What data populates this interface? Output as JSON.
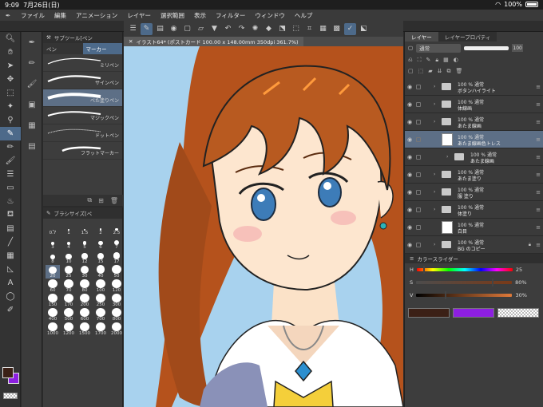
{
  "status": {
    "time": "9:09",
    "date": "7月26日(日)",
    "battery": "100%"
  },
  "menu": [
    "ファイル",
    "編集",
    "アニメーション",
    "レイヤー",
    "選択範囲",
    "表示",
    "フィルター",
    "ウィンドウ",
    "ヘルプ"
  ],
  "subtool": {
    "title": "サブツール[ペン",
    "tabs": [
      "ペン",
      "マーカー"
    ],
    "brushes": [
      "ミリペン",
      "サインペン",
      "べた塗りペン",
      "マジックペン",
      "ドットペン",
      "フラットマーカー"
    ],
    "selected_brush": "べた塗りペン"
  },
  "brushsize": {
    "title": "ブラシサイズ[ペ",
    "sizes": [
      "0.7",
      "1",
      "1.5",
      "2",
      "2.5",
      "3",
      "4",
      "5",
      "6",
      "7",
      "8",
      "10",
      "12",
      "15",
      "17",
      "20",
      "25",
      "30",
      "40",
      "50",
      "60",
      "70",
      "80",
      "100",
      "120",
      "150",
      "170",
      "200",
      "250",
      "300",
      "400",
      "500",
      "600",
      "700",
      "800",
      "1000",
      "1200",
      "1500",
      "1700",
      "2000"
    ],
    "selected": "20"
  },
  "canvas": {
    "tab_title": "イラスト64* (ポストカード 100.00 x 148.00mm 350dpi 361.7%)"
  },
  "layers": {
    "tabs": [
      "レイヤー",
      "レイヤープロパティ"
    ],
    "blend_mode": "通常",
    "opacity": "100",
    "items": [
      {
        "line1": "100 % 通常",
        "line2": "ボタンハイライト",
        "kind": "folder"
      },
      {
        "line1": "100 % 通常",
        "line2": "体線画",
        "kind": "folder"
      },
      {
        "line1": "100 % 通常",
        "line2": "あたま線画",
        "kind": "folder"
      },
      {
        "line1": "100 % 通常",
        "line2": "あたま線画色トレス",
        "kind": "raster"
      },
      {
        "line1": "100 % 通常",
        "line2": "あたま線画",
        "kind": "folder"
      },
      {
        "line1": "100 % 通常",
        "line2": "あたま塗り",
        "kind": "folder"
      },
      {
        "line1": "100 % 通常",
        "line2": "服 塗り",
        "kind": "folder"
      },
      {
        "line1": "100 % 通常",
        "line2": "体塗り",
        "kind": "folder"
      },
      {
        "line1": "100 % 通常",
        "line2": "白目",
        "kind": "raster"
      },
      {
        "line1": "100 % 通常",
        "line2": "BG のコピー",
        "kind": "folder"
      }
    ]
  },
  "color_slider": {
    "title": "カラースライダー",
    "h": {
      "label": "H",
      "value": "25",
      "fraction": 0.07
    },
    "s": {
      "label": "S",
      "value": "80%",
      "fraction": 0.8
    },
    "v": {
      "label": "V",
      "value": "30%",
      "fraction": 0.3
    },
    "main_color": "#3b2016",
    "sub_color": "#8d1fe0"
  }
}
